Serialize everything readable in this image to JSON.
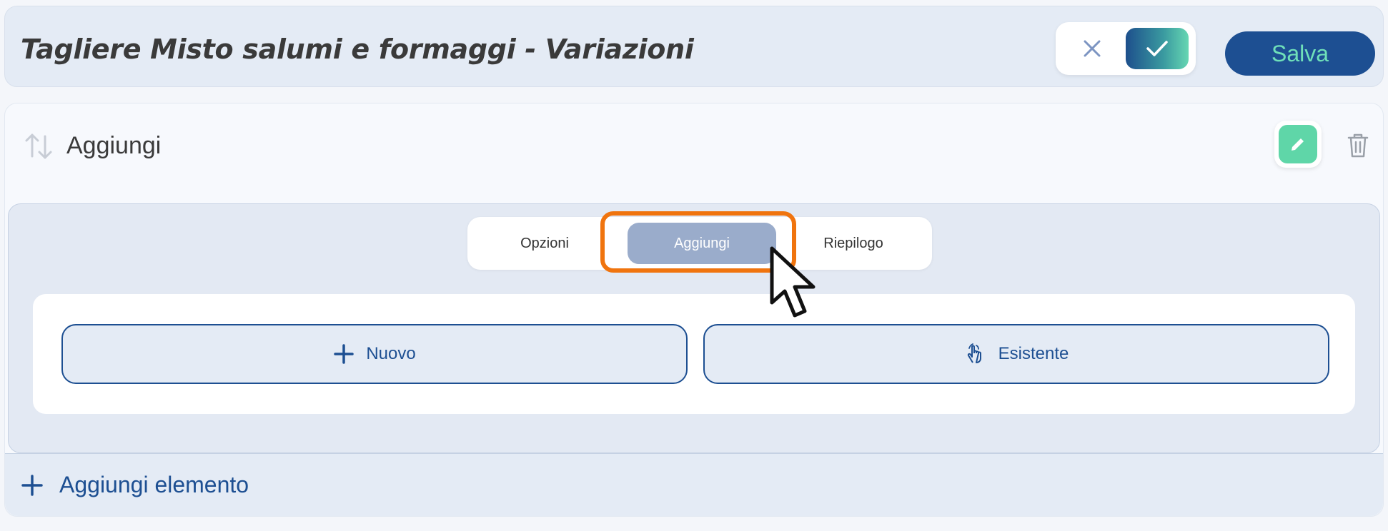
{
  "header": {
    "title": "Tagliere Misto salumi e formaggi - Variazioni",
    "save_label": "Salva"
  },
  "section": {
    "title": "Aggiungi"
  },
  "tabs": [
    {
      "label": "Opzioni",
      "active": false
    },
    {
      "label": "Aggiungi",
      "active": true
    },
    {
      "label": "Riepilogo",
      "active": false
    }
  ],
  "options": {
    "new_label": "Nuovo",
    "existing_label": "Esistente"
  },
  "footer": {
    "add_element_label": "Aggiungi elemento"
  },
  "colors": {
    "primary": "#1d4f92",
    "accent": "#5fd6a8",
    "highlight": "#f0740e",
    "active_tab": "#9aaccb"
  },
  "icons": [
    "close-icon",
    "check-icon",
    "sort-arrows-icon",
    "pencil-icon",
    "trash-icon",
    "plus-icon",
    "hand-pointer-icon",
    "cursor-icon"
  ]
}
